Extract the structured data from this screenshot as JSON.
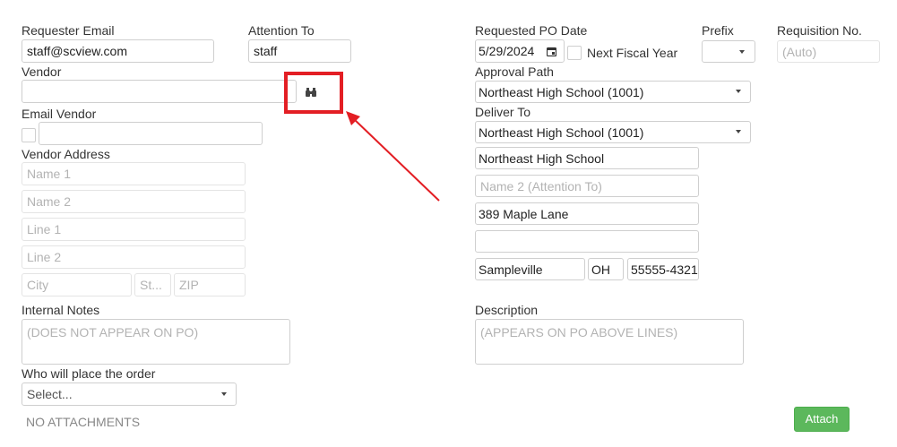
{
  "labels": {
    "requester_email": "Requester Email",
    "attention_to": "Attention To",
    "vendor": "Vendor",
    "email_vendor": "Email Vendor",
    "vendor_address": "Vendor Address",
    "internal_notes": "Internal Notes",
    "who_place_order": "Who will place the order",
    "no_attachments": "NO ATTACHMENTS",
    "requested_po_date": "Requested PO Date",
    "prefix": "Prefix",
    "requisition_no": "Requisition No.",
    "next_fiscal_year": "Next Fiscal Year",
    "approval_path": "Approval Path",
    "deliver_to": "Deliver To",
    "description": "Description"
  },
  "fields": {
    "requester_email": "staff@scview.com",
    "attention_to": "staff",
    "vendor": "",
    "email_vendor": "",
    "requested_po_date": "5/29/2024",
    "requisition_no_placeholder": "(Auto)",
    "prefix": "",
    "approval_path": "Northeast High School (1001)",
    "deliver_to": "Northeast High School (1001)",
    "who_place_order": "Select...",
    "internal_notes_placeholder": "(DOES NOT APPEAR ON PO)",
    "description_placeholder": "(APPEARS ON PO ABOVE LINES)"
  },
  "vendor_address": {
    "name1_placeholder": "Name 1",
    "name2_placeholder": "Name 2",
    "line1_placeholder": "Line 1",
    "line2_placeholder": "Line 2",
    "city_placeholder": "City",
    "state_placeholder": "St...",
    "zip_placeholder": "ZIP"
  },
  "deliver_address": {
    "name1": "Northeast High School",
    "name2_placeholder": "Name 2 (Attention To)",
    "line1": "389 Maple Lane",
    "line2": "",
    "city": "Sampleville",
    "state": "OH",
    "zip": "55555-4321"
  },
  "buttons": {
    "attach": "Attach"
  },
  "colors": {
    "highlight": "#e31e24",
    "attach_button": "#5cb85c"
  },
  "icons": {
    "vendor_lookup": "binoculars-icon",
    "calendar": "calendar-icon"
  }
}
